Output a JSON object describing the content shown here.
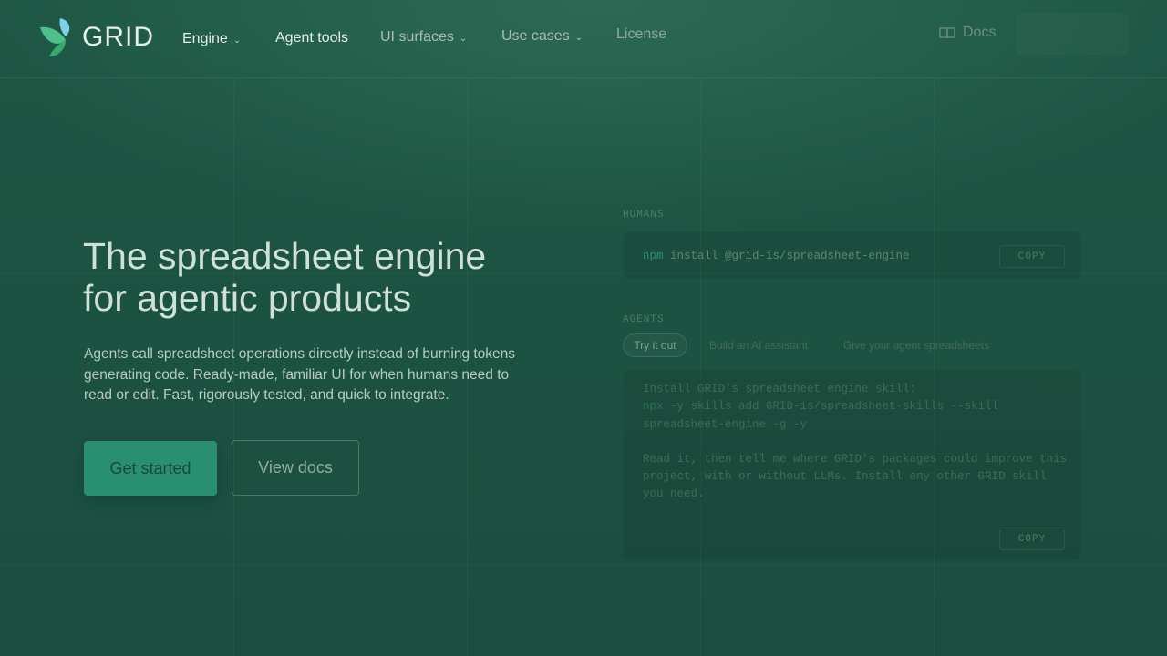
{
  "header": {
    "logo_text": "GRID",
    "nav": [
      {
        "label": "Engine",
        "has_dropdown": true
      },
      {
        "label": "Agent tools",
        "has_dropdown": false
      },
      {
        "label": "UI surfaces",
        "has_dropdown": true
      },
      {
        "label": "Use cases",
        "has_dropdown": true
      },
      {
        "label": "License",
        "has_dropdown": false
      }
    ],
    "docs_label": "Docs",
    "docs_icon": "book-icon",
    "signin_label": ""
  },
  "hero": {
    "title_line1": "The spreadsheet engine",
    "title_line2": "for agentic products",
    "subtitle": "Agents call spreadsheet operations directly instead of burning tokens generating code. Ready-made, familiar UI for when humans need to read or edit. Fast, rigorously tested, and quick to integrate.",
    "primary_button": "Get started",
    "secondary_button": "View docs"
  },
  "humans": {
    "label": "HUMANS",
    "command_prefix": "npm",
    "command_rest": " install @grid-is/spreadsheet-engine",
    "copy_label": "COPY"
  },
  "agents": {
    "label": "AGENTS",
    "tabs": [
      {
        "label": "Try it out",
        "active": true
      },
      {
        "label": "Build an AI assistant",
        "active": false
      },
      {
        "label": "Give your agent spreadsheets",
        "active": false
      }
    ],
    "line1": "Install GRID's spreadsheet engine skill:",
    "line2_prefix": "npx",
    "line2_rest": " -y skills add GRID-is/spreadsheet-skills --skill",
    "line3": "spreadsheet-engine -g -y",
    "paragraph": "Read it, then tell me where GRID's packages could improve this project, with or without LLMs. Install any other GRID skill you need.",
    "copy_label": "COPY"
  },
  "colors": {
    "background": "#1c5242",
    "accent": "#2a8f70",
    "text": "#cfe0d8"
  }
}
